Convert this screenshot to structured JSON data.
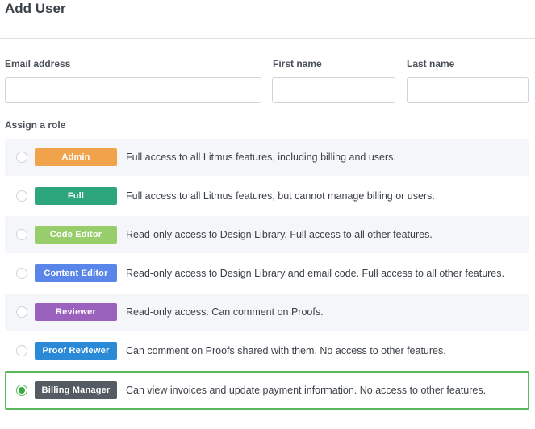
{
  "page": {
    "title": "Add User"
  },
  "form": {
    "email": {
      "label": "Email address",
      "value": "",
      "placeholder": ""
    },
    "first_name": {
      "label": "First name",
      "value": "",
      "placeholder": ""
    },
    "last_name": {
      "label": "Last name",
      "value": "",
      "placeholder": ""
    },
    "role_section_label": "Assign a role"
  },
  "roles": [
    {
      "name": "Admin",
      "color": "#f0a34b",
      "description": "Full access to all Litmus features, including billing and users.",
      "selected": false
    },
    {
      "name": "Full",
      "color": "#2ea67d",
      "description": "Full access to all Litmus features, but cannot manage billing or users.",
      "selected": false
    },
    {
      "name": "Code Editor",
      "color": "#98cd6b",
      "description": "Read-only access to Design Library. Full access to all other features.",
      "selected": false
    },
    {
      "name": "Content Editor",
      "color": "#5a86ea",
      "description": "Read-only access to Design Library and email code. Full access to all other features.",
      "selected": false
    },
    {
      "name": "Reviewer",
      "color": "#9b62bd",
      "description": "Read-only access. Can comment on Proofs.",
      "selected": false
    },
    {
      "name": "Proof Reviewer",
      "color": "#2b8ad8",
      "description": "Can comment on Proofs shared with them. No access to other features.",
      "selected": false
    },
    {
      "name": "Billing Manager",
      "color": "#545b62",
      "description": "Can view invoices and update payment information. No access to other features.",
      "selected": true
    }
  ],
  "colors": {
    "selected_border": "#5cb85c",
    "radio_selected": "#3aa843"
  }
}
